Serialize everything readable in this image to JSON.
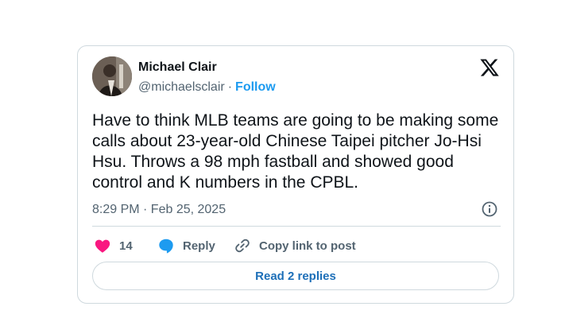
{
  "author": {
    "name": "Michael Clair",
    "handle": "@michaelsclair",
    "separator": "·",
    "follow_label": "Follow"
  },
  "tweet": {
    "text": "Have to think MLB teams are going to be making some calls about 23-year-old Chinese Taipei pitcher Jo-Hsi Hsu. Throws a 98 mph fastball and showed good control and K numbers in the CPBL.",
    "timestamp": "8:29 PM · Feb 25, 2025"
  },
  "actions": {
    "like_count": "14",
    "reply_label": "Reply",
    "copy_label": "Copy link to post"
  },
  "replies_button": "Read 2 replies",
  "icons": {
    "logo": "x-logo-icon",
    "info": "info-icon",
    "like": "heart-icon",
    "reply": "speech-bubble-icon",
    "copy": "link-icon"
  },
  "colors": {
    "like": "#f91880",
    "reply": "#1d9bf0",
    "follow": "#1d9bf0",
    "secondary_text": "#536471",
    "border": "#cfd9de"
  }
}
